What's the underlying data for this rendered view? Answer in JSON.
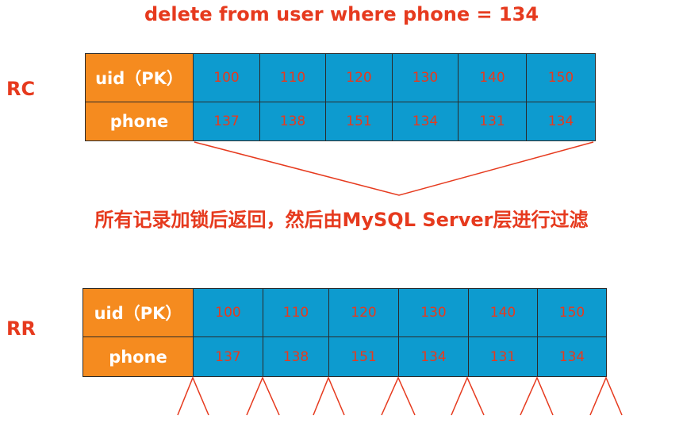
{
  "title": "delete from user where phone = 134",
  "note": "所有记录加锁后返回，然后由MySQL Server层进行过滤",
  "colors": {
    "header_bg": "#f58b1f",
    "cell_bg": "#0d9bcf",
    "accent_red": "#e63a1e",
    "border": "#2a2a2a"
  },
  "tables": [
    {
      "isolation": "RC",
      "rows": [
        {
          "label": "uid（PK）",
          "values": [
            "100",
            "110",
            "120",
            "130",
            "140",
            "150"
          ]
        },
        {
          "label": "phone",
          "values": [
            "137",
            "138",
            "151",
            "134",
            "131",
            "134"
          ]
        }
      ]
    },
    {
      "isolation": "RR",
      "rows": [
        {
          "label": "uid（PK）",
          "values": [
            "100",
            "110",
            "120",
            "130",
            "140",
            "150"
          ]
        },
        {
          "label": "phone",
          "values": [
            "137",
            "138",
            "151",
            "134",
            "131",
            "134"
          ]
        }
      ]
    }
  ]
}
